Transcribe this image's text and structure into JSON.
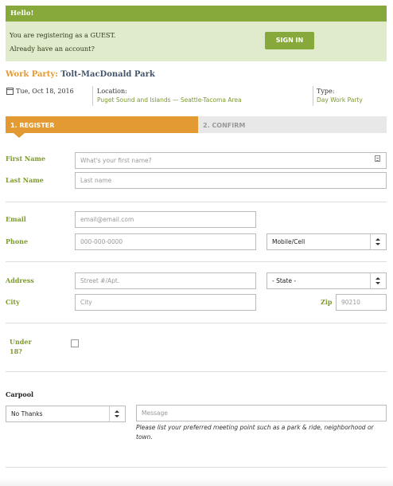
{
  "banner": {
    "greeting": "Hello!",
    "guest_text": "You are registering as a GUEST.",
    "account_text": "Already have an account?",
    "signin_label": "SIGN IN"
  },
  "event": {
    "title_label": "Work Party:",
    "title_name": "Tolt-MacDonald Park",
    "date": "Tue, Oct 18, 2016",
    "location_label": "Location:",
    "location_value": "Puget Sound and Islands  — Seattle-Tacoma Area",
    "type_label": "Type:",
    "type_value": "Day Work Party"
  },
  "steps": {
    "step1": "1. REGISTER",
    "step2": "2. CONFIRM"
  },
  "form": {
    "first_name_label": "First Name",
    "first_name_placeholder": "What's your first name?",
    "last_name_label": "Last Name",
    "last_name_placeholder": "Last name",
    "email_label": "Email",
    "email_placeholder": "email@email.com",
    "phone_label": "Phone",
    "phone_placeholder": "000-000-0000",
    "phone_type_value": "Mobile/Cell",
    "address_label": "Address",
    "address_placeholder": "Street #/Apt.",
    "state_value": "- State -",
    "city_label": "City",
    "city_placeholder": "City",
    "zip_label": "Zip",
    "zip_placeholder": "90210",
    "under18_label": "Under 18?",
    "carpool_label": "Carpool",
    "carpool_value": "No Thanks",
    "message_placeholder": "Message",
    "carpool_hint": "Please list your preferred meeting point such as a park & ride, neighborhood or town."
  },
  "colors": {
    "green": "#87a83a",
    "orange": "#e39a32",
    "light_green": "#e0ebcb"
  }
}
